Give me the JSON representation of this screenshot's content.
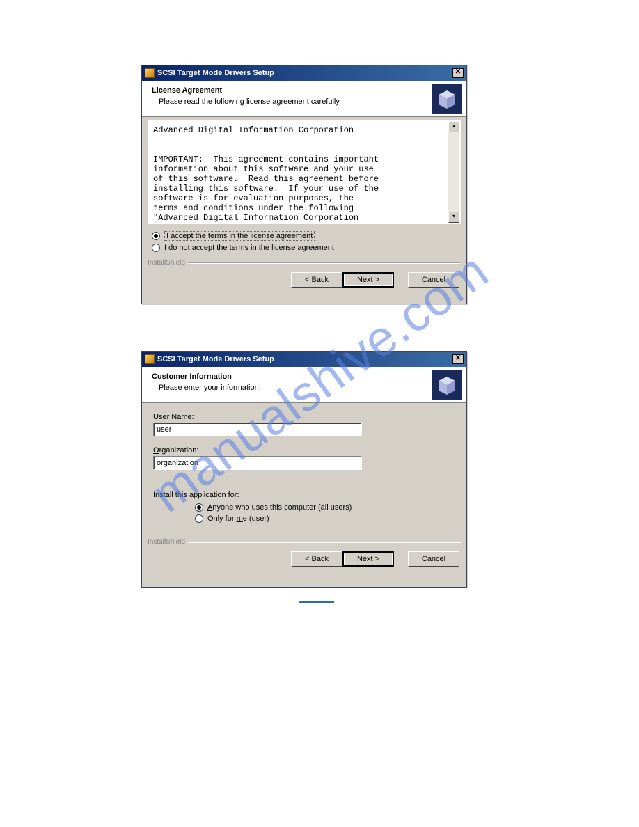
{
  "watermark": "manualshive.com",
  "dialog1": {
    "title": "SCSI Target Mode Drivers Setup",
    "header_title": "License Agreement",
    "header_sub": "Please read the following license agreement carefully.",
    "license_text": "Advanced Digital Information Corporation\n\n\nIMPORTANT:  This agreement contains important\ninformation about this software and your use\nof this software.  Read this agreement before\ninstalling this software.  If your use of the\nsoftware is for evaluation purposes, the\nterms and conditions under the following\n\"Advanced Digital Information Corporation",
    "radio_accept": "I accept the terms in the license agreement",
    "radio_reject": "I do not accept the terms in the license agreement",
    "brand": "InstallShield",
    "btn_back": "< Back",
    "btn_next": "Next >",
    "btn_cancel": "Cancel"
  },
  "dialog2": {
    "title": "SCSI Target Mode Drivers Setup",
    "header_title": "Customer Information",
    "header_sub": "Please enter your information.",
    "user_label": "User Name:",
    "user_value": "user",
    "org_label": "Organization:",
    "org_value": "organization",
    "install_for_label": "Install this application for:",
    "radio_anyone": "Anyone who uses this computer (all users)",
    "radio_onlyme": "Only for me (user)",
    "brand": "InstallShield",
    "btn_back": "< Back",
    "btn_next": "Next >",
    "btn_cancel": "Cancel"
  }
}
